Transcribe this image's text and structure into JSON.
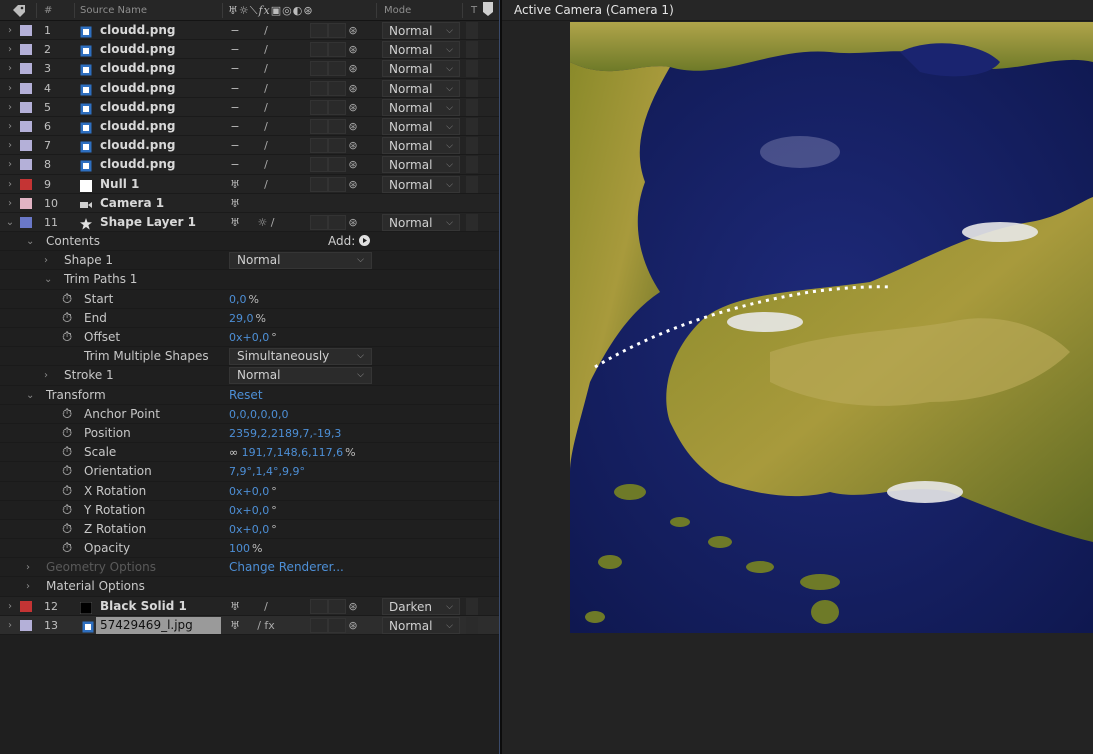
{
  "header": {
    "num_label": "#",
    "source_label": "Source Name",
    "mode_label": "Mode",
    "t_label": "T",
    "switch_icons": [
      "puppet-pin-icon",
      "sun-icon",
      "brush-icon",
      "fx-icon",
      "frame-blend-icon",
      "motion-blur-icon",
      "adjustment-icon",
      "3d-cube-icon"
    ]
  },
  "layers": [
    {
      "num": "1",
      "name": "cloudd.png",
      "color": "#b4b0d8",
      "icon": "image-file-icon",
      "sw1": "−",
      "sw2": "/",
      "mode": "Normal"
    },
    {
      "num": "2",
      "name": "cloudd.png",
      "color": "#b4b0d8",
      "icon": "image-file-icon",
      "sw1": "−",
      "sw2": "/",
      "mode": "Normal"
    },
    {
      "num": "3",
      "name": "cloudd.png",
      "color": "#b4b0d8",
      "icon": "image-file-icon",
      "sw1": "−",
      "sw2": "/",
      "mode": "Normal"
    },
    {
      "num": "4",
      "name": "cloudd.png",
      "color": "#b4b0d8",
      "icon": "image-file-icon",
      "sw1": "−",
      "sw2": "/",
      "mode": "Normal"
    },
    {
      "num": "5",
      "name": "cloudd.png",
      "color": "#b4b0d8",
      "icon": "image-file-icon",
      "sw1": "−",
      "sw2": "/",
      "mode": "Normal"
    },
    {
      "num": "6",
      "name": "cloudd.png",
      "color": "#b4b0d8",
      "icon": "image-file-icon",
      "sw1": "−",
      "sw2": "/",
      "mode": "Normal"
    },
    {
      "num": "7",
      "name": "cloudd.png",
      "color": "#b4b0d8",
      "icon": "image-file-icon",
      "sw1": "−",
      "sw2": "/",
      "mode": "Normal"
    },
    {
      "num": "8",
      "name": "cloudd.png",
      "color": "#b4b0d8",
      "icon": "image-file-icon",
      "sw1": "−",
      "sw2": "/",
      "mode": "Normal"
    },
    {
      "num": "9",
      "name": "Null 1",
      "color": "#c43434",
      "icon": "null-icon",
      "sw1": "♅",
      "sw2": "/",
      "mode": "Normal"
    },
    {
      "num": "10",
      "name": "Camera 1",
      "color": "#e2b4c4",
      "icon": "camera-icon",
      "sw1": "♅",
      "sw2": "",
      "mode": ""
    },
    {
      "num": "11",
      "name": "Shape Layer 1",
      "color": "#6a78c8",
      "icon": "star-icon",
      "sw1": "♅",
      "sw2": "☼ /",
      "mode": "Normal"
    }
  ],
  "properties": {
    "contents": "Contents",
    "add_label": "Add:",
    "shape1": "Shape 1",
    "shape1_mode": "Normal",
    "trim_paths": "Trim Paths 1",
    "start_label": "Start",
    "start_value": "0,0",
    "start_unit": "%",
    "end_label": "End",
    "end_value": "29,0",
    "end_unit": "%",
    "offset_label": "Offset",
    "offset_value": "0x+0,0",
    "offset_unit": "°",
    "trim_multiple_label": "Trim Multiple Shapes",
    "trim_multiple_value": "Simultaneously",
    "stroke1": "Stroke 1",
    "stroke1_mode": "Normal",
    "transform": "Transform",
    "reset": "Reset",
    "anchor_label": "Anchor Point",
    "anchor_value": "0,0,0,0,0,0",
    "position_label": "Position",
    "position_value": "2359,2,2189,7,-19,3",
    "scale_label": "Scale",
    "scale_value": "191,7,148,6,117,6",
    "scale_unit": "%",
    "orientation_label": "Orientation",
    "orientation_value": "7,9°,1,4°,9,9°",
    "xrot_label": "X Rotation",
    "xrot_value": "0x+0,0",
    "yrot_label": "Y Rotation",
    "yrot_value": "0x+0,0",
    "zrot_label": "Z Rotation",
    "zrot_value": "0x+0,0",
    "rot_unit": "°",
    "opacity_label": "Opacity",
    "opacity_value": "100",
    "opacity_unit": "%",
    "geometry_options": "Geometry Options",
    "change_renderer": "Change Renderer...",
    "material_options": "Material Options"
  },
  "layers_bottom": [
    {
      "num": "12",
      "name": "Black Solid 1",
      "color": "#c43434",
      "icon": "solid-icon",
      "sw1": "♅",
      "sw2": "/",
      "mode": "Darken"
    },
    {
      "num": "13",
      "name": "57429469_l.jpg",
      "color": "#b4b0d8",
      "icon": "image-file-icon",
      "sw1": "♅",
      "sw2": "/ fx",
      "mode": "Normal"
    }
  ],
  "viewer": {
    "title": "Active Camera (Camera 1)"
  },
  "colors": {
    "link_blue": "#4d8fd6",
    "label_lavender": "#b4b0d8",
    "label_red": "#c43434",
    "label_pink": "#e2b4c4",
    "label_blue": "#6a78c8"
  }
}
